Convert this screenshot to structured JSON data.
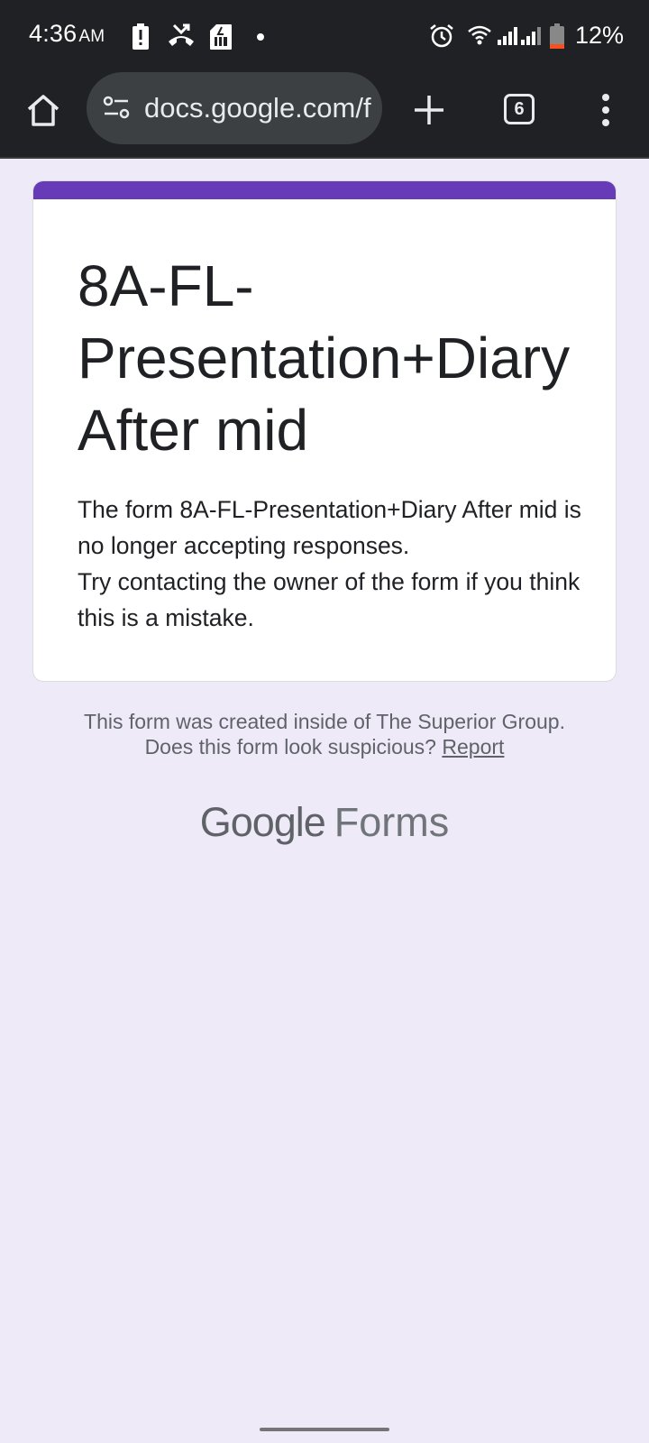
{
  "status_bar": {
    "time": "4:36",
    "ampm": "AM",
    "battery_percent": "12%",
    "icons": [
      "battery-alert-icon",
      "missed-call-icon",
      "sim-card-icon",
      "notification-dot-icon",
      "alarm-icon",
      "wifi-icon",
      "signal-icon",
      "signal-icon",
      "battery-icon"
    ]
  },
  "browser": {
    "url": "docs.google.com/forms",
    "tab_count": "6",
    "icons": [
      "home-icon",
      "tune-icon",
      "plus-icon",
      "tabs-icon",
      "more-vert-icon"
    ]
  },
  "form": {
    "title": "8A-FL-Presentation+Diary After mid",
    "message_line1": "The form 8A-FL-Presentation+Diary After mid is no longer accepting responses.",
    "message_line2": "Try contacting the owner of the form if you think this is a mistake.",
    "accent_color": "#673ab7"
  },
  "footer": {
    "created_text": "This form was created inside of The Superior Group.",
    "suspicious_text": "Does this form look suspicious?",
    "report_label": "Report",
    "logo_google": "Google",
    "logo_forms": "Forms"
  }
}
